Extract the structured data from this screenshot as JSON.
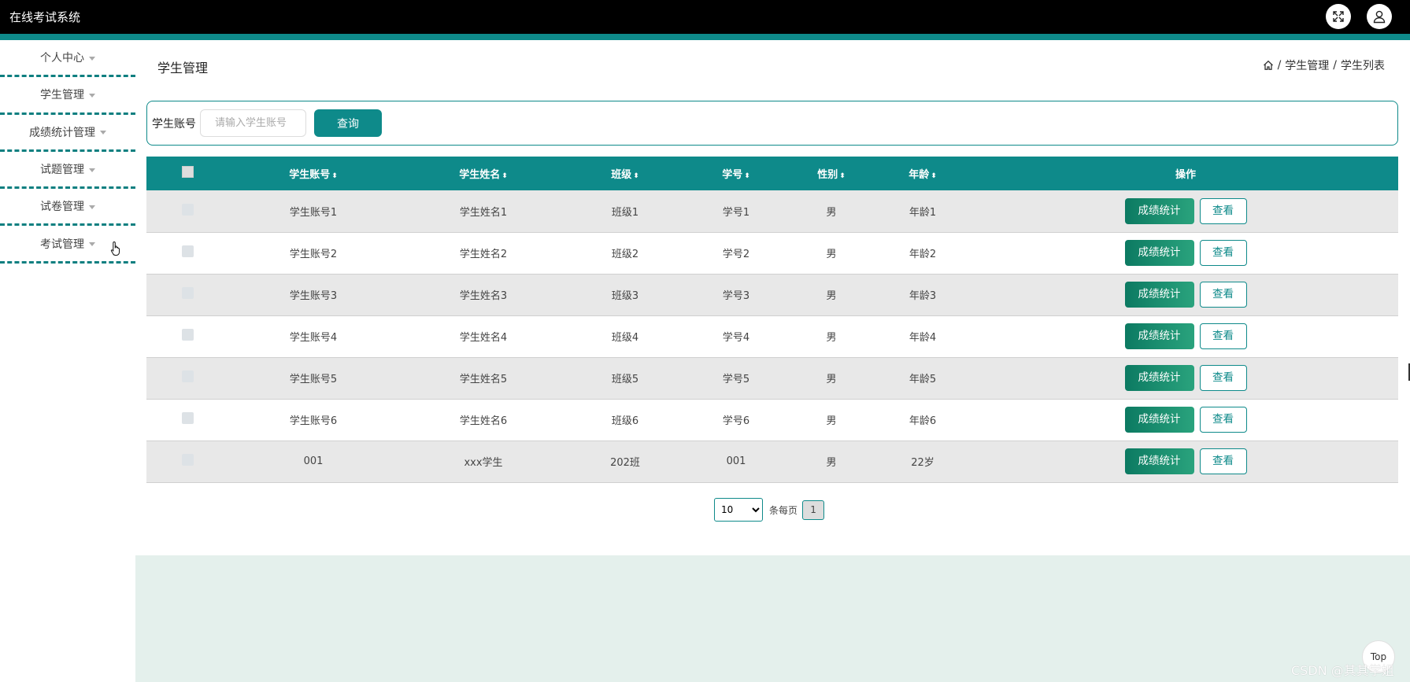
{
  "app": {
    "title": "在线考试系统"
  },
  "sidebar": {
    "items": [
      {
        "label": "个人中心"
      },
      {
        "label": "学生管理"
      },
      {
        "label": "成绩统计管理"
      },
      {
        "label": "试题管理"
      },
      {
        "label": "试卷管理"
      },
      {
        "label": "考试管理"
      }
    ]
  },
  "header": {
    "page_title": "学生管理",
    "breadcrumb": {
      "sep": "/",
      "item1": "学生管理",
      "item2": "学生列表"
    }
  },
  "search": {
    "label": "学生账号",
    "placeholder": "请输入学生账号",
    "button": "查询"
  },
  "table": {
    "headers": {
      "account": "学生账号",
      "name": "学生姓名",
      "class": "班级",
      "number": "学号",
      "gender": "性别",
      "age": "年龄",
      "ops": "操作"
    },
    "rows": [
      {
        "account": "学生账号1",
        "name": "学生姓名1",
        "class": "班级1",
        "number": "学号1",
        "gender": "男",
        "age": "年龄1"
      },
      {
        "account": "学生账号2",
        "name": "学生姓名2",
        "class": "班级2",
        "number": "学号2",
        "gender": "男",
        "age": "年龄2"
      },
      {
        "account": "学生账号3",
        "name": "学生姓名3",
        "class": "班级3",
        "number": "学号3",
        "gender": "男",
        "age": "年龄3"
      },
      {
        "account": "学生账号4",
        "name": "学生姓名4",
        "class": "班级4",
        "number": "学号4",
        "gender": "男",
        "age": "年龄4"
      },
      {
        "account": "学生账号5",
        "name": "学生姓名5",
        "class": "班级5",
        "number": "学号5",
        "gender": "男",
        "age": "年龄5"
      },
      {
        "account": "学生账号6",
        "name": "学生姓名6",
        "class": "班级6",
        "number": "学号6",
        "gender": "男",
        "age": "年龄6"
      },
      {
        "account": "001",
        "name": "xxx学生",
        "class": "202班",
        "number": "001",
        "gender": "男",
        "age": "22岁"
      }
    ],
    "stat_button": "成绩统计",
    "view_button": "查看"
  },
  "pagination": {
    "page_size": "10",
    "per_page_label": "条每页",
    "current_page": "1"
  },
  "back_to_top": "Top",
  "watermark": "CSDN @其其学姐",
  "colors": {
    "accent": "#0e8a8a",
    "topbar": "#000000",
    "footer": "#e4f0ec"
  }
}
